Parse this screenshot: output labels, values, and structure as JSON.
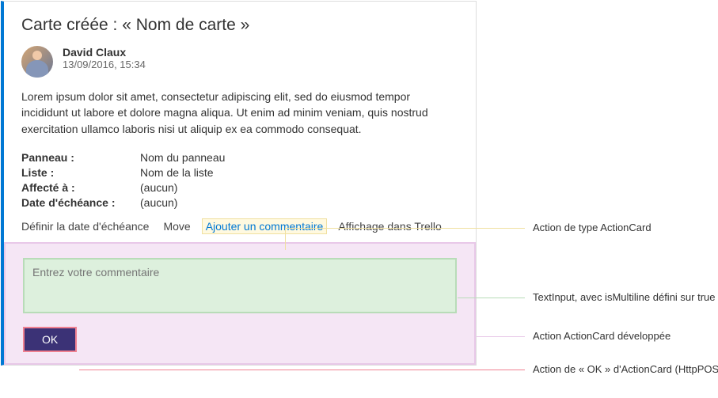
{
  "card": {
    "title": "Carte créée : « Nom de carte »",
    "author": {
      "name": "David Claux",
      "date": "13/09/2016, 15:34"
    },
    "description": "Lorem ipsum dolor sit amet, consectetur adipiscing elit, sed do eiusmod tempor incididunt ut labore et dolore magna aliqua. Ut enim ad minim veniam, quis nostrud exercitation ullamco laboris nisi ut aliquip ex ea commodo consequat.",
    "facts": [
      {
        "label": "Panneau :",
        "value": "Nom du panneau"
      },
      {
        "label": "Liste :",
        "value": "Nom de la liste"
      },
      {
        "label": "Affecté à :",
        "value": "(aucun)"
      },
      {
        "label": "Date d'échéance :",
        "value": "(aucun)"
      }
    ],
    "actions": [
      {
        "label": "Définir la date d'échéance",
        "selected": false
      },
      {
        "label": "Move",
        "selected": false
      },
      {
        "label": "Ajouter un commentaire",
        "selected": true
      },
      {
        "label": "Affichage dans Trello",
        "selected": false
      }
    ],
    "comment_placeholder": "Entrez votre commentaire",
    "ok_label": "OK"
  },
  "annotations": {
    "a1": "Action de type ActionCard",
    "a2": "TextInput, avec isMultiline défini sur true",
    "a3": "Action ActionCard développée",
    "a4": "Action de « OK » d'ActionCard (HttpPOST)"
  }
}
